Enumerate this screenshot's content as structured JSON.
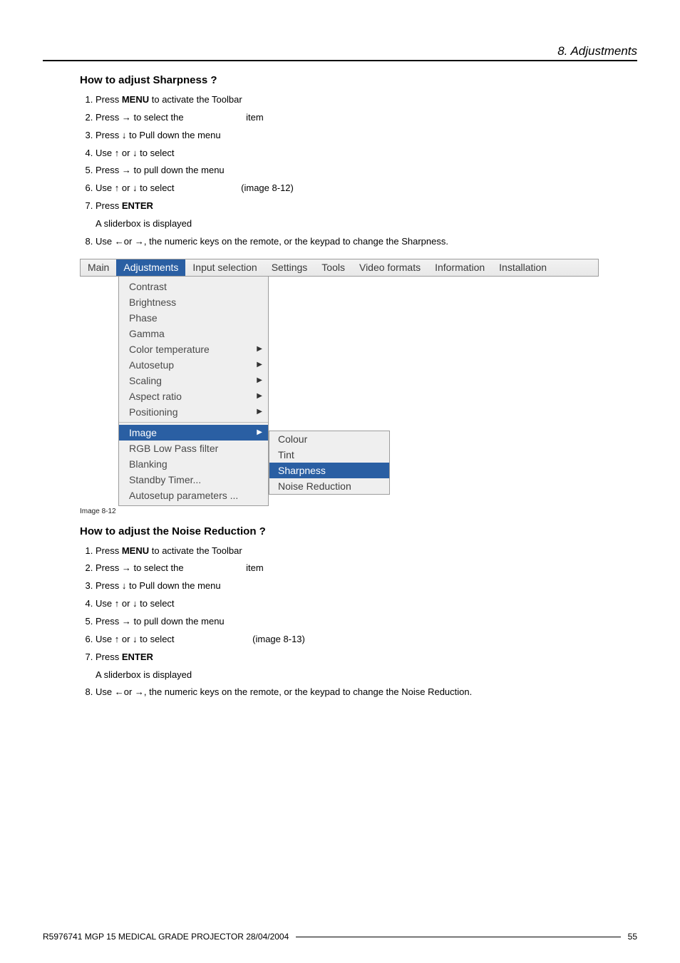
{
  "header": {
    "section_title": "8.  Adjustments"
  },
  "sharpness": {
    "heading": "How to adjust Sharpness ?",
    "steps": {
      "s1_a": "Press ",
      "s1_b": "MENU",
      "s1_c": " to activate the Toolbar",
      "s2_a": "Press → to select the ",
      "s2_b": "item",
      "s3": "Press ↓ to Pull down the menu",
      "s4": "Use ↑ or ↓ to select ",
      "s5": "Press → to pull down the menu",
      "s6_a": "Use ↑ or ↓ to select ",
      "s6_b": "(image 8-12)",
      "s7_a": "Press ",
      "s7_b": "ENTER",
      "s7_sub": "A sliderbox is displayed",
      "s8": "Use ←or →, the numeric keys on the remote, or the keypad to change the Sharpness."
    },
    "caption": "Image 8-12"
  },
  "noise": {
    "heading": "How to adjust the Noise Reduction ?",
    "steps": {
      "s1_a": "Press ",
      "s1_b": "MENU",
      "s1_c": " to activate the Toolbar",
      "s2_a": "Press → to select the ",
      "s2_b": "item",
      "s3": "Press ↓ to Pull down the menu",
      "s4": "Use ↑ or ↓ to select ",
      "s5": "Press → to pull down the menu",
      "s6_a": "Use ↑ or ↓ to select ",
      "s6_b": "(image 8-13)",
      "s7_a": "Press ",
      "s7_b": "ENTER",
      "s7_sub": "A sliderbox is displayed",
      "s8": "Use ←or →, the numeric keys on the remote, or the keypad to change the Noise Reduction."
    }
  },
  "menu": {
    "bar": [
      "Main",
      "Adjustments",
      "Input selection",
      "Settings",
      "Tools",
      "Video formats",
      "Information",
      "Installation"
    ],
    "bar_selected_index": 1,
    "dropdown_groups": [
      {
        "items": [
          {
            "label": "Contrast",
            "arrow": false
          },
          {
            "label": "Brightness",
            "arrow": false
          },
          {
            "label": "Phase",
            "arrow": false
          },
          {
            "label": "Gamma",
            "arrow": false
          },
          {
            "label": "Color temperature",
            "arrow": true
          },
          {
            "label": "Autosetup",
            "arrow": true
          },
          {
            "label": "Scaling",
            "arrow": true
          },
          {
            "label": "Aspect ratio",
            "arrow": true
          },
          {
            "label": "Positioning",
            "arrow": true
          }
        ]
      },
      {
        "items": [
          {
            "label": "Image",
            "arrow": true,
            "selected": true
          },
          {
            "label": "RGB Low Pass filter",
            "arrow": false
          },
          {
            "label": "Blanking",
            "arrow": false
          },
          {
            "label": "Standby Timer...",
            "arrow": false
          },
          {
            "label": "Autosetup parameters ...",
            "arrow": false
          }
        ]
      }
    ],
    "submenu": [
      {
        "label": "Colour"
      },
      {
        "label": "Tint"
      },
      {
        "label": "Sharpness",
        "selected": true
      },
      {
        "label": "Noise Reduction"
      }
    ]
  },
  "footer": {
    "text": "R5976741  MGP 15 MEDICAL GRADE PROJECTOR  28/04/2004",
    "page": "55"
  }
}
